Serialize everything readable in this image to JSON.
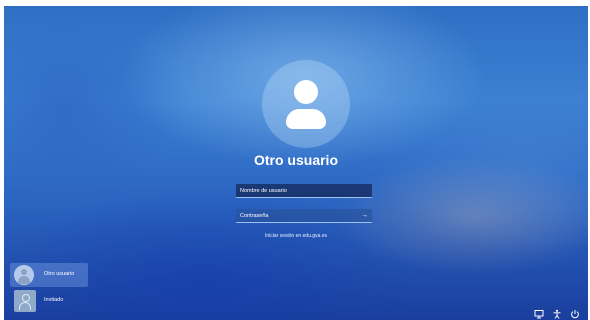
{
  "login": {
    "username": "Otro usuario",
    "username_placeholder": "Nombre de usuario",
    "password_placeholder": "Contraseña",
    "submit_icon": "arrow-right-icon",
    "signin_link": "Iniciar sesión en edu.gva.es"
  },
  "users": [
    {
      "label": "Otro usuario",
      "icon": "user-avatar-icon",
      "selected": true
    },
    {
      "label": "Invitado",
      "icon": "guest-avatar-icon",
      "selected": false
    }
  ],
  "system_tray": {
    "icons": [
      "network-icon",
      "accessibility-icon",
      "power-icon"
    ]
  },
  "colors": {
    "background": "#2f6fc4",
    "field_bg": "#14285a",
    "text": "#ffffff"
  }
}
